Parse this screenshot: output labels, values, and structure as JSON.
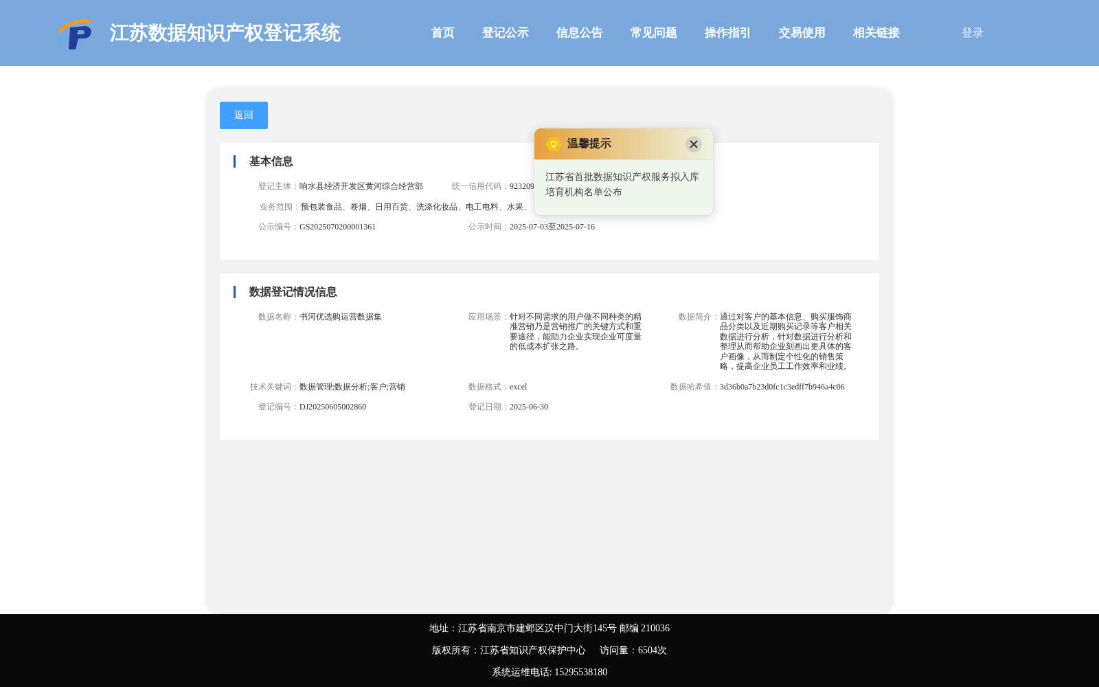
{
  "header": {
    "title": "江苏数据知识产权登记系统",
    "nav": [
      {
        "label": "首页",
        "selected": false
      },
      {
        "label": "登记公示",
        "selected": false
      },
      {
        "label": "信息公告",
        "selected": false
      },
      {
        "label": "常见问题",
        "selected": false
      },
      {
        "label": "操作指引",
        "selected": false
      },
      {
        "label": "交易使用",
        "selected": false
      },
      {
        "label": "相关链接",
        "selected": false
      }
    ],
    "login": "登录"
  },
  "back_button": "返回",
  "sections": [
    {
      "title": "基本信息",
      "fields": [
        {
          "label": "登记主体：",
          "value": "响水县经济开发区黄河综合经营部",
          "kind": "cell"
        },
        {
          "label": "统一信用代码：",
          "value": "923209",
          "kind": "cell"
        },
        {
          "label": "业务范围：",
          "value": "预包装食品、卷烟、日用百货、洗涤化妆品、电工电料、水果、",
          "kind": "row"
        },
        {
          "label": "公示编号：",
          "value": "GS2025070200001361",
          "kind": "cell"
        },
        {
          "label": "公示时间：",
          "value": "2025-07-03至2025-07-16",
          "kind": "cell"
        }
      ]
    },
    {
      "title": "数据登记情况信息",
      "fields": [
        {
          "label": "数据名称：",
          "value": "书河优选购运营数据集",
          "kind": "cell"
        },
        {
          "label": "应用场景：",
          "value": "针对不同需求的用户做不同种类的精准营销乃是营销推广的关键方式和重要途径，能助力企业实现企业可度量的低成本扩张之路。",
          "kind": "cell"
        },
        {
          "label": "数据简介：",
          "value": "通过对客户的基本信息、购买服饰商品分类以及近期购买记录等客户相关数据进行分析，针对数据进行分析和整理从而帮助企业刻画出更具体的客户画像，从而制定个性化的销售策略，提高企业员工工作效率和业绩。",
          "kind": "cell"
        },
        {
          "label": "技术关键词：",
          "value": "数据管理;数据分析;客户;营销",
          "kind": "cell"
        },
        {
          "label": "数据格式：",
          "value": "excel",
          "kind": "cell"
        },
        {
          "label": "数据哈希值：",
          "value": "3d36b0a7b23d0fc1c3edff7b946a4c06",
          "kind": "cell"
        },
        {
          "label": "登记编号：",
          "value": "DJ20250605002860",
          "kind": "cell"
        },
        {
          "label": "登记日期：",
          "value": "2025-06-30",
          "kind": "cell"
        }
      ]
    }
  ],
  "notice": {
    "title": "温馨提示",
    "message": "江苏省首批数据知识产权服务拟入库培育机构名单公布"
  },
  "footer": {
    "lines": [
      "地址：江苏省南京市建邺区汉中门大街145号 邮编 210036",
      "版权所有：江苏省知识产权保护中心",
      "访问量：6504次",
      "系统运维电话: 15295538180"
    ]
  }
}
